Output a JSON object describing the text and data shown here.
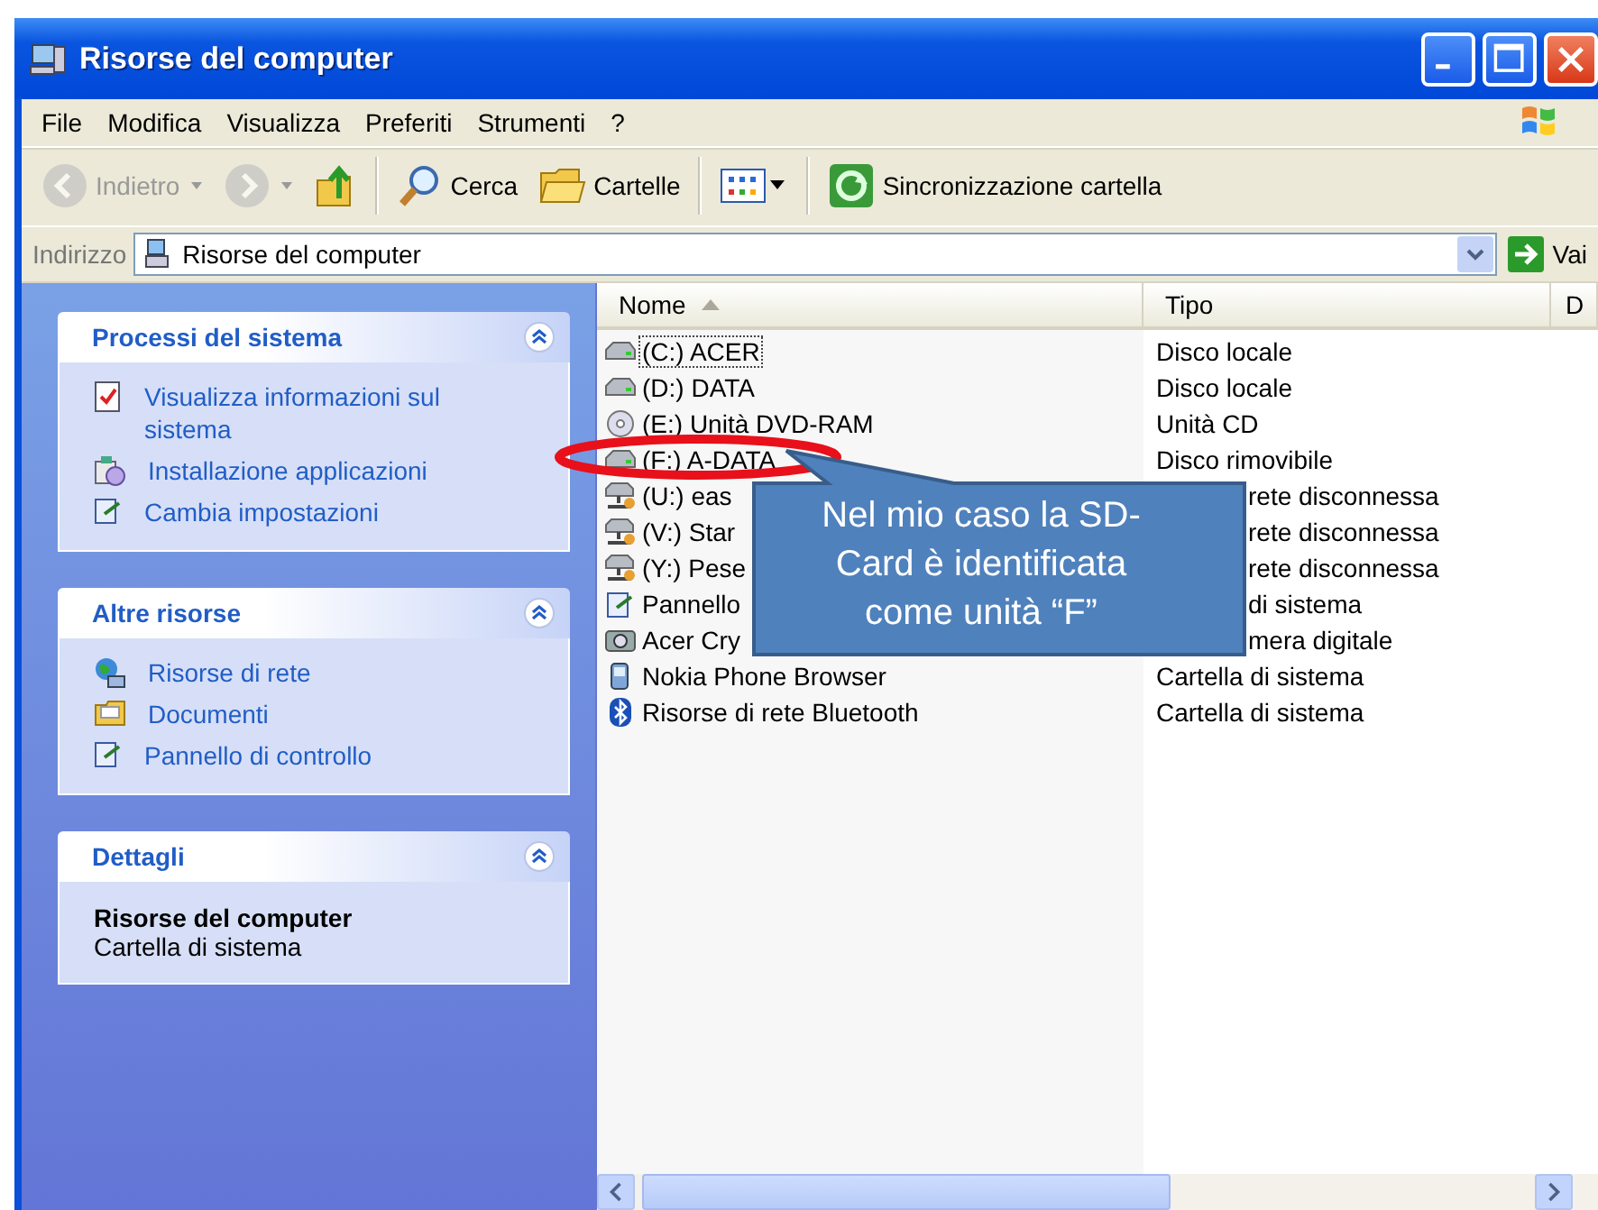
{
  "window": {
    "title": "Risorse del computer"
  },
  "menu": [
    "File",
    "Modifica",
    "Visualizza",
    "Preferiti",
    "Strumenti",
    "?"
  ],
  "toolbar": [
    {
      "kind": "back",
      "label": "Indietro",
      "disabled": true
    },
    {
      "kind": "forward",
      "disabled": true
    },
    {
      "kind": "up",
      "disabled": false
    },
    {
      "kind": "search",
      "label": "Cerca",
      "disabled": false
    },
    {
      "kind": "folders",
      "label": "Cartelle",
      "disabled": false
    },
    {
      "kind": "views",
      "disabled": false
    },
    {
      "kind": "sync",
      "label": "Sincronizzazione cartella",
      "disabled": false
    }
  ],
  "address": {
    "label": "Indirizzo",
    "value": "Risorse del computer",
    "go": "Vai"
  },
  "tasks": [
    {
      "title": "Processi del sistema",
      "expanded": true,
      "links": [
        {
          "kind": "sysinfo",
          "label": "Visualizza informazioni sul sistema"
        },
        {
          "kind": "install",
          "label": "Installazione applicazioni"
        },
        {
          "kind": "panel",
          "label": "Cambia impostazioni"
        }
      ]
    },
    {
      "title": "Altre risorse",
      "expanded": true,
      "links": [
        {
          "kind": "network",
          "label": "Risorse di rete"
        },
        {
          "kind": "docs",
          "label": "Documenti"
        },
        {
          "kind": "panel",
          "label": "Pannello di controllo"
        }
      ]
    },
    {
      "title": "Dettagli",
      "expanded": true,
      "details": {
        "name": "Risorse del computer",
        "type": "Cartella di sistema"
      }
    }
  ],
  "list": {
    "columns": [
      {
        "label": "Nome",
        "sorted": true
      },
      {
        "label": "Tipo",
        "sorted": false
      },
      {
        "label": "D",
        "sorted": false
      }
    ],
    "rows": [
      {
        "kind": "drive",
        "name": "(C:) ACER",
        "type": "Disco locale",
        "selected": false,
        "focused": true,
        "covered": false
      },
      {
        "kind": "drive",
        "name": "(D:) DATA",
        "type": "Disco locale",
        "selected": false,
        "focused": false,
        "covered": false
      },
      {
        "kind": "cd",
        "name": "(E:) Unità DVD-RAM",
        "type": "Unità CD",
        "selected": false,
        "focused": false,
        "covered": false
      },
      {
        "kind": "drive",
        "name": "(F:) A-DATA",
        "type": "Disco rimovibile",
        "selected": false,
        "focused": false,
        "covered": false
      },
      {
        "kind": "netdrive",
        "name": "(U:) eas",
        "type": "rete disconnessa",
        "selected": false,
        "focused": false,
        "covered": true
      },
      {
        "kind": "netdrive",
        "name": "(V:) Star",
        "type": "rete disconnessa",
        "selected": false,
        "focused": false,
        "covered": true
      },
      {
        "kind": "netdrive",
        "name": "(Y:) Pese",
        "type": "rete disconnessa",
        "selected": false,
        "focused": false,
        "covered": true
      },
      {
        "kind": "panel",
        "name": "Pannello",
        "type": "di sistema",
        "selected": false,
        "focused": false,
        "covered": true
      },
      {
        "kind": "camera",
        "name": "Acer Cry",
        "type": "mera digitale",
        "selected": false,
        "focused": false,
        "covered": true
      },
      {
        "kind": "phone",
        "name": "Nokia Phone Browser",
        "type": "Cartella di sistema",
        "selected": false,
        "focused": false,
        "covered": false
      },
      {
        "kind": "bluetooth",
        "name": "Risorse di rete Bluetooth",
        "type": "Cartella di sistema",
        "selected": false,
        "focused": false,
        "covered": false
      }
    ]
  },
  "callout": {
    "text": "Nel mio caso la SD-Card è identificata come unità “F”"
  }
}
